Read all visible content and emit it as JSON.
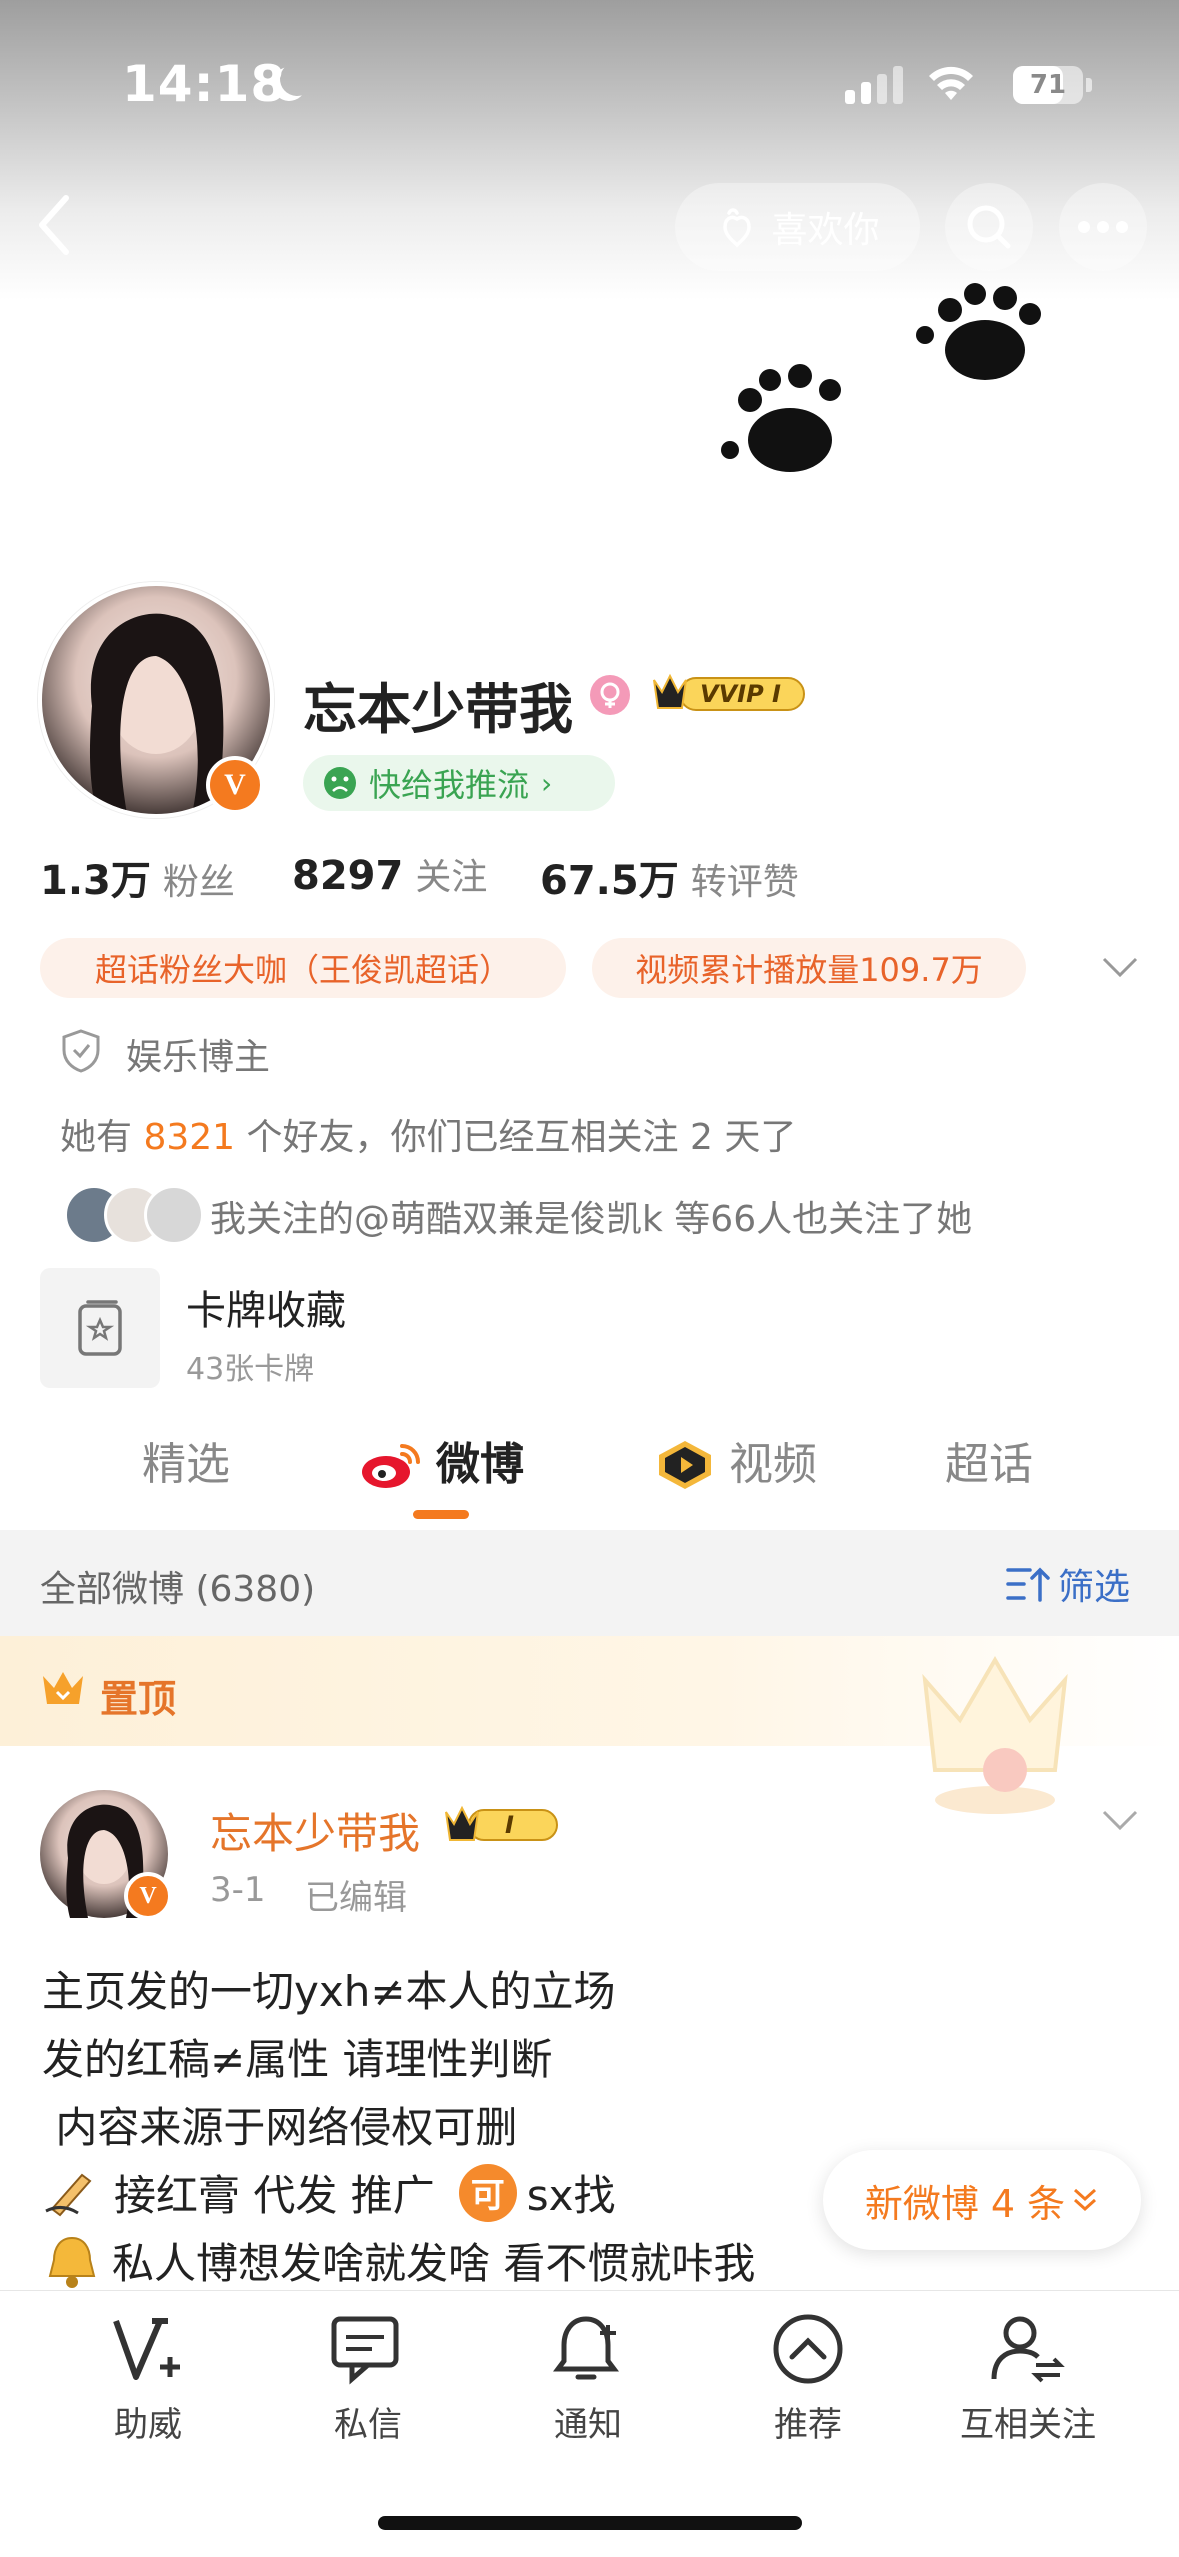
{
  "status_bar": {
    "time": "14:18",
    "battery": "71"
  },
  "header": {
    "like_label": "喜欢你"
  },
  "profile": {
    "name": "忘本少带我",
    "vip_label": "VVIP I",
    "push_label": "快给我推流",
    "stats": [
      {
        "value": "1.3万",
        "label": "粉丝"
      },
      {
        "value": "8297",
        "label": "关注"
      },
      {
        "value": "67.5万",
        "label": "转评赞"
      }
    ],
    "tags": [
      "超话粉丝大咖（王俊凯超话）",
      "视频累计播放量109.7万"
    ],
    "role": "娱乐博主",
    "friends_prefix": "她有 ",
    "friends_count": "8321",
    "friends_suffix": " 个好友，你们已经互相关注 2 天了",
    "mutual_text": "我关注的@萌酷双兼是俊凯k 等66人也关注了她",
    "card_title": "卡牌收藏",
    "card_count": "43张卡牌"
  },
  "tabs": [
    "精选",
    "微博",
    "视频",
    "超话"
  ],
  "feed": {
    "filter_label": "全部微博 (6380)",
    "filter_button": "筛选",
    "pinned_label": "置顶",
    "post": {
      "author": "忘本少带我",
      "level": "I",
      "date": "3-1",
      "edited": "已编辑",
      "lines": [
        "主页发的一切yxh≠本人的立场",
        "发的红稿≠属性 请理性判断",
        " 内容来源于网络侵权可删",
        "接红膏 代发 推广",
        "sx找",
        "私人博想发啥就发啥 看不惯就咔我"
      ]
    },
    "new_posts_label": "新微博 4 条"
  },
  "tabbar": [
    "助威",
    "私信",
    "通知",
    "推荐",
    "互相关注"
  ],
  "colors": {
    "accent": "#f47a1f",
    "green": "#3aa452",
    "tag_bg": "#fdf1ea"
  }
}
